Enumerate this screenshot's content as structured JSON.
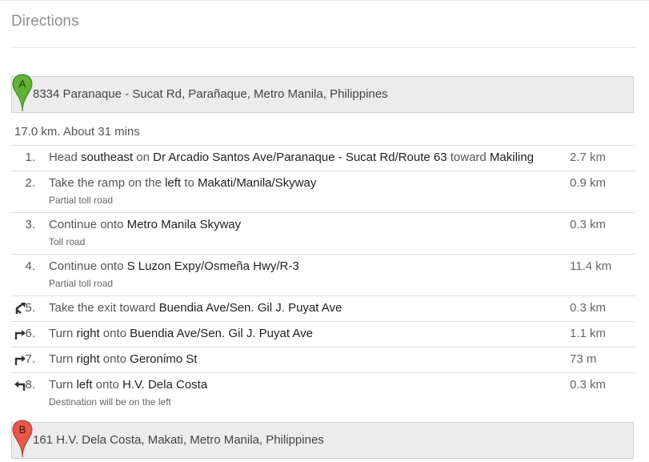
{
  "panel": {
    "title": "Directions"
  },
  "origin": {
    "marker": "A",
    "address": "8334 Paranaque - Sucat Rd, Parañaque, Metro Manila, Philippines",
    "marker_color": "#5fb236"
  },
  "route": {
    "summary": "17.0 km. About 31 mins"
  },
  "steps": [
    {
      "num": "1.",
      "parts": [
        [
          "Head ",
          false
        ],
        [
          "southeast",
          true
        ],
        [
          " on ",
          false
        ],
        [
          "Dr Arcadio Santos Ave/Paranaque - Sucat Rd/Route 63",
          true
        ],
        [
          " toward ",
          false
        ],
        [
          "Makiling",
          true
        ]
      ],
      "note": "",
      "distance": "2.7 km",
      "icon": ""
    },
    {
      "num": "2.",
      "parts": [
        [
          "Take the ramp on the ",
          false
        ],
        [
          "left",
          true
        ],
        [
          " to ",
          false
        ],
        [
          "Makati/Manila/Skyway",
          true
        ]
      ],
      "note": "Partial toll road",
      "distance": "0.9 km",
      "icon": ""
    },
    {
      "num": "3.",
      "parts": [
        [
          "Continue onto ",
          false
        ],
        [
          "Metro Manila Skyway",
          true
        ]
      ],
      "note": "Toll road",
      "distance": "0.3 km",
      "icon": ""
    },
    {
      "num": "4.",
      "parts": [
        [
          "Continue onto ",
          false
        ],
        [
          "S Luzon Expy/Osmeña Hwy/R-3",
          true
        ]
      ],
      "note": "Partial toll road",
      "distance": "11.4 km",
      "icon": ""
    },
    {
      "num": "5.",
      "parts": [
        [
          "Take the exit toward ",
          false
        ],
        [
          "Buendia Ave/Sen. Gil J. Puyat Ave",
          true
        ]
      ],
      "note": "",
      "distance": "0.3 km",
      "icon": "ramp-right-icon"
    },
    {
      "num": "6.",
      "parts": [
        [
          "Turn ",
          false
        ],
        [
          "right",
          true
        ],
        [
          " onto ",
          false
        ],
        [
          "Buendia Ave/Sen. Gil J. Puyat Ave",
          true
        ]
      ],
      "note": "",
      "distance": "1.1 km",
      "icon": "turn-right-icon"
    },
    {
      "num": "7.",
      "parts": [
        [
          "Turn ",
          false
        ],
        [
          "right",
          true
        ],
        [
          " onto ",
          false
        ],
        [
          "Geronimo St",
          true
        ]
      ],
      "note": "",
      "distance": "73 m",
      "icon": "turn-right-icon"
    },
    {
      "num": "8.",
      "parts": [
        [
          "Turn ",
          false
        ],
        [
          "left",
          true
        ],
        [
          " onto ",
          false
        ],
        [
          "H.V. Dela Costa",
          true
        ]
      ],
      "note": "Destination will be on the left",
      "distance": "0.3 km",
      "icon": "turn-left-icon"
    }
  ],
  "destination": {
    "marker": "B",
    "address": "161 H.V. Dela Costa, Makati, Metro Manila, Philippines",
    "marker_color": "#e8574a"
  }
}
